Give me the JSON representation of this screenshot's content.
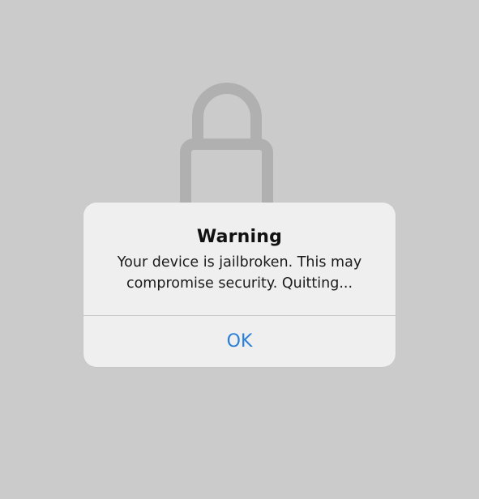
{
  "background": {
    "icon": "lock-icon",
    "color": "#cbcbcb",
    "icon_color": "#b0b0b0"
  },
  "alert": {
    "title": "Warning",
    "message_line1": "Your device is jailbroken. This may",
    "message_line2": "compromise security. Quitting...",
    "button_label": "OK",
    "button_color": "#2b7fd6"
  }
}
